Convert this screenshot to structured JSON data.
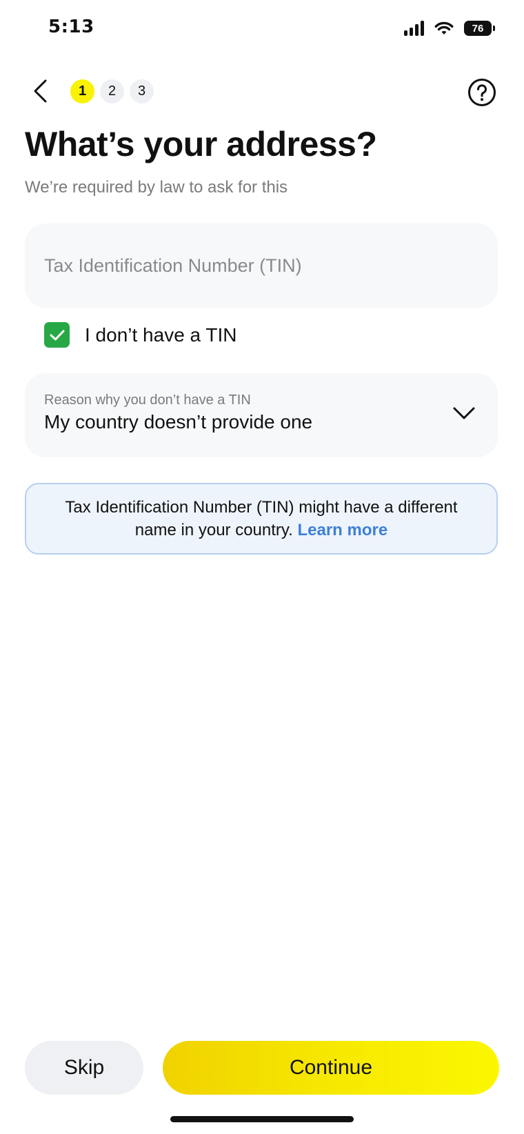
{
  "status_bar": {
    "time": "5:13",
    "battery": "76"
  },
  "header": {
    "steps": [
      "1",
      "2",
      "3"
    ],
    "active_step": "1"
  },
  "main": {
    "title": "What’s your address?",
    "subtitle": "We’re required by law to ask for this",
    "tin_field": {
      "placeholder": "Tax Identification Number (TIN)",
      "value": ""
    },
    "no_tin_checkbox": {
      "label": "I don’t have a TIN",
      "checked": true
    },
    "reason_select": {
      "label": "Reason why you don’t have a TIN",
      "value": "My country doesn’t provide one"
    },
    "info": {
      "text": "Tax Identification Number (TIN) might have a different name in your country. ",
      "link": "Learn more"
    }
  },
  "footer": {
    "skip_label": "Skip",
    "continue_label": "Continue"
  },
  "colors": {
    "accent_yellow": "#f9f201",
    "checkbox_green": "#27a844",
    "link_blue": "#3d7fd9"
  }
}
